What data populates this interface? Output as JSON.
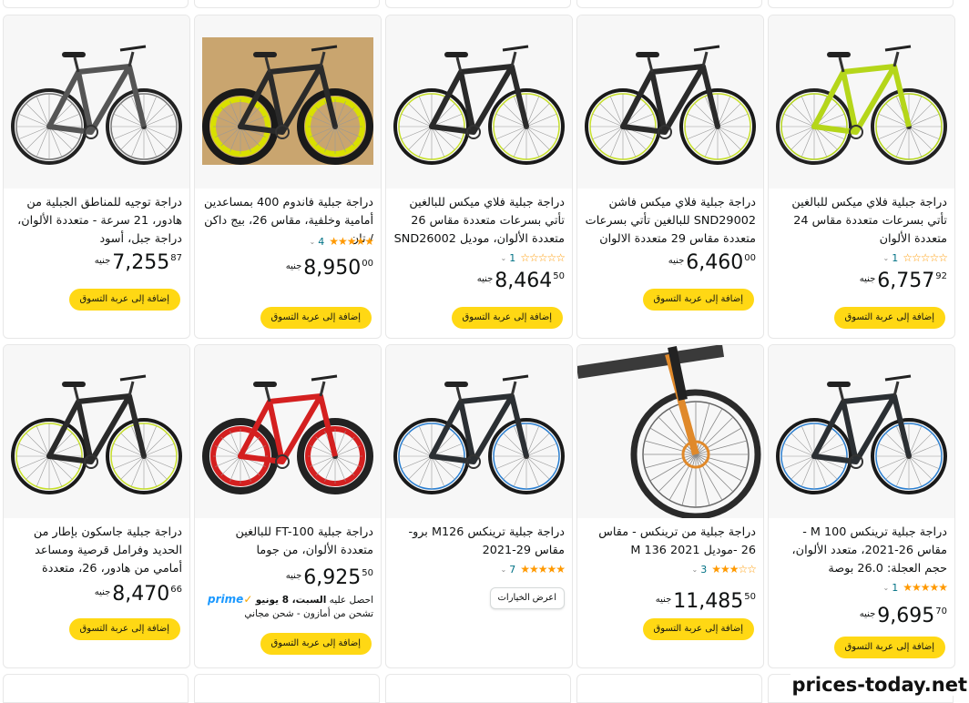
{
  "currency_label": "جنيه",
  "cart_label": "إضافة إلى عربة التسوق",
  "options_label": "اعرض الخيارات",
  "watermark": "prices-today.net",
  "colors": {
    "star": "#ff9900",
    "link": "#007185",
    "cart_button": "#ffd814",
    "prime": "#1a98ff"
  },
  "products": [
    {
      "title": "دراجة جبلية فلاي ميكس للبالغين تأتي بسرعات متعددة مقاس 24 متعددة الألوان",
      "rating_stars": "☆☆☆☆☆",
      "rating_count": "1",
      "price_whole": "6,757",
      "price_frac": "92",
      "bike": "lime"
    },
    {
      "title": "دراجة جبلية فلاي ميكس فاشن SND29002 للبالغين تأتي بسرعات متعددة مقاس 29 متعددة الالوان",
      "rating_stars": "",
      "rating_count": "",
      "price_whole": "6,460",
      "price_frac": "00",
      "bike": "black-lime"
    },
    {
      "title": "دراجة جبلية فلاي ميكس للبالغين تأتي بسرعات متعددة مقاس 26 متعددة الألوان، موديل SND26002",
      "rating_stars": "☆☆☆☆☆",
      "rating_count": "1",
      "price_whole": "8,464",
      "price_frac": "50",
      "bike": "black-lime"
    },
    {
      "title": "دراجة جبلية فاندوم 400 بمساعدين أمامية وخلفية، مقاس 26، بيج داكن / تان",
      "rating_stars": "★★★★★",
      "rating_count": "4",
      "price_whole": "8,950",
      "price_frac": "00",
      "bike": "fat-yellow"
    },
    {
      "title": "دراجة توجيه للمناطق الجبلية من هادور، 21 سرعة - متعددة الألوان، دراجة جبل، أسود",
      "rating_stars": "",
      "rating_count": "",
      "price_whole": "7,255",
      "price_frac": "87",
      "bike": "grey"
    },
    {
      "title": "دراجة جبلية ترينكس M 100 - مقاس 26-2021، متعدد الألوان، حجم العجلة: 26.0 بوصة",
      "rating_stars": "★★★★★",
      "rating_count": "1",
      "price_whole": "9,695",
      "price_frac": "70",
      "bike": "black-blue"
    },
    {
      "title": "دراجة جبلية من ترينكس - مقاس 26 -موديل M 136 2021",
      "rating_stars": "★★★☆☆",
      "rating_count": "3",
      "price_whole": "11,485",
      "price_frac": "50",
      "bike": "closeup"
    },
    {
      "title": "دراجة جبلية ترينكس M126 برو-مقاس 29-2021",
      "rating_stars": "★★★★★",
      "rating_count": "7",
      "price_whole": "",
      "price_frac": "",
      "bike": "black-blue"
    },
    {
      "title": "دراجة جبلية FT-100 للبالغين متعددة الألوان، من جوما",
      "rating_stars": "",
      "rating_count": "",
      "price_whole": "6,925",
      "price_frac": "50",
      "bike": "fat-red",
      "prime_logo": "prime",
      "prime_text": "احصل عليه",
      "prime_day": "السبت، 8 يونيو",
      "prime_ship": "تشحن من أمازون - شحن مجاني"
    },
    {
      "title": "دراجة جبلية جاسكون بإطار من الحديد وفرامل قرصية ومساعد أمامي من هادور، 26، متعددة الألوان",
      "rating_stars": "",
      "rating_count": "",
      "price_whole": "8,470",
      "price_frac": "66",
      "bike": "black-lime"
    }
  ]
}
